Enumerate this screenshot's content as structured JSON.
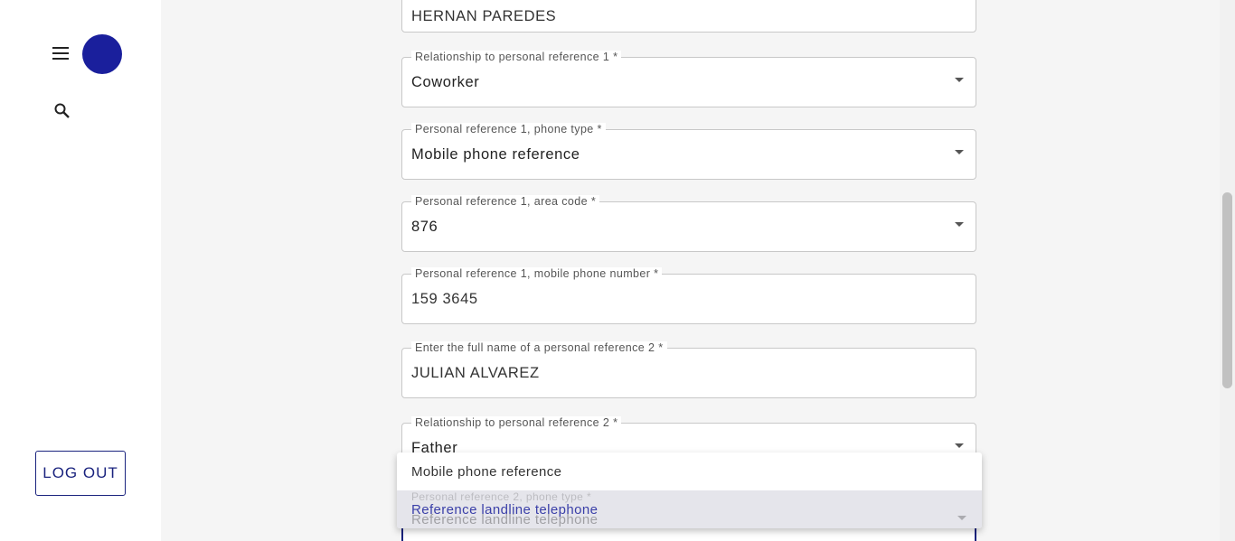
{
  "sidebar": {
    "menu_icon": "hamburger-menu-icon",
    "search_icon": "search-icon",
    "avatar_color": "#1a1f9c",
    "logout_label": "LOG OUT"
  },
  "form": {
    "fields": [
      {
        "label": "",
        "value": "HERNAN PAREDES",
        "type": "text"
      },
      {
        "label": "Relationship to personal reference 1 *",
        "value": "Coworker",
        "type": "select"
      },
      {
        "label": "Personal reference 1, phone type *",
        "value": "Mobile phone reference",
        "type": "select"
      },
      {
        "label": "Personal reference 1, area code *",
        "value": "876",
        "type": "select"
      },
      {
        "label": "Personal reference 1, mobile phone number *",
        "value": "159 3645",
        "type": "text"
      },
      {
        "label": "Enter the full name of a personal reference 2 *",
        "value": "JULIAN ALVAREZ",
        "type": "text"
      },
      {
        "label": "Relationship to personal reference 2 *",
        "value": "Father",
        "type": "select"
      },
      {
        "label": "Personal reference 2, phone type *",
        "value": "Reference landline telephone",
        "type": "select"
      }
    ]
  },
  "dropdown": {
    "options": [
      "Mobile phone reference",
      "Reference landline telephone"
    ],
    "selected_index": 1
  },
  "colors": {
    "accent": "#1a237e",
    "selected_option_text": "#3a3fa8"
  }
}
